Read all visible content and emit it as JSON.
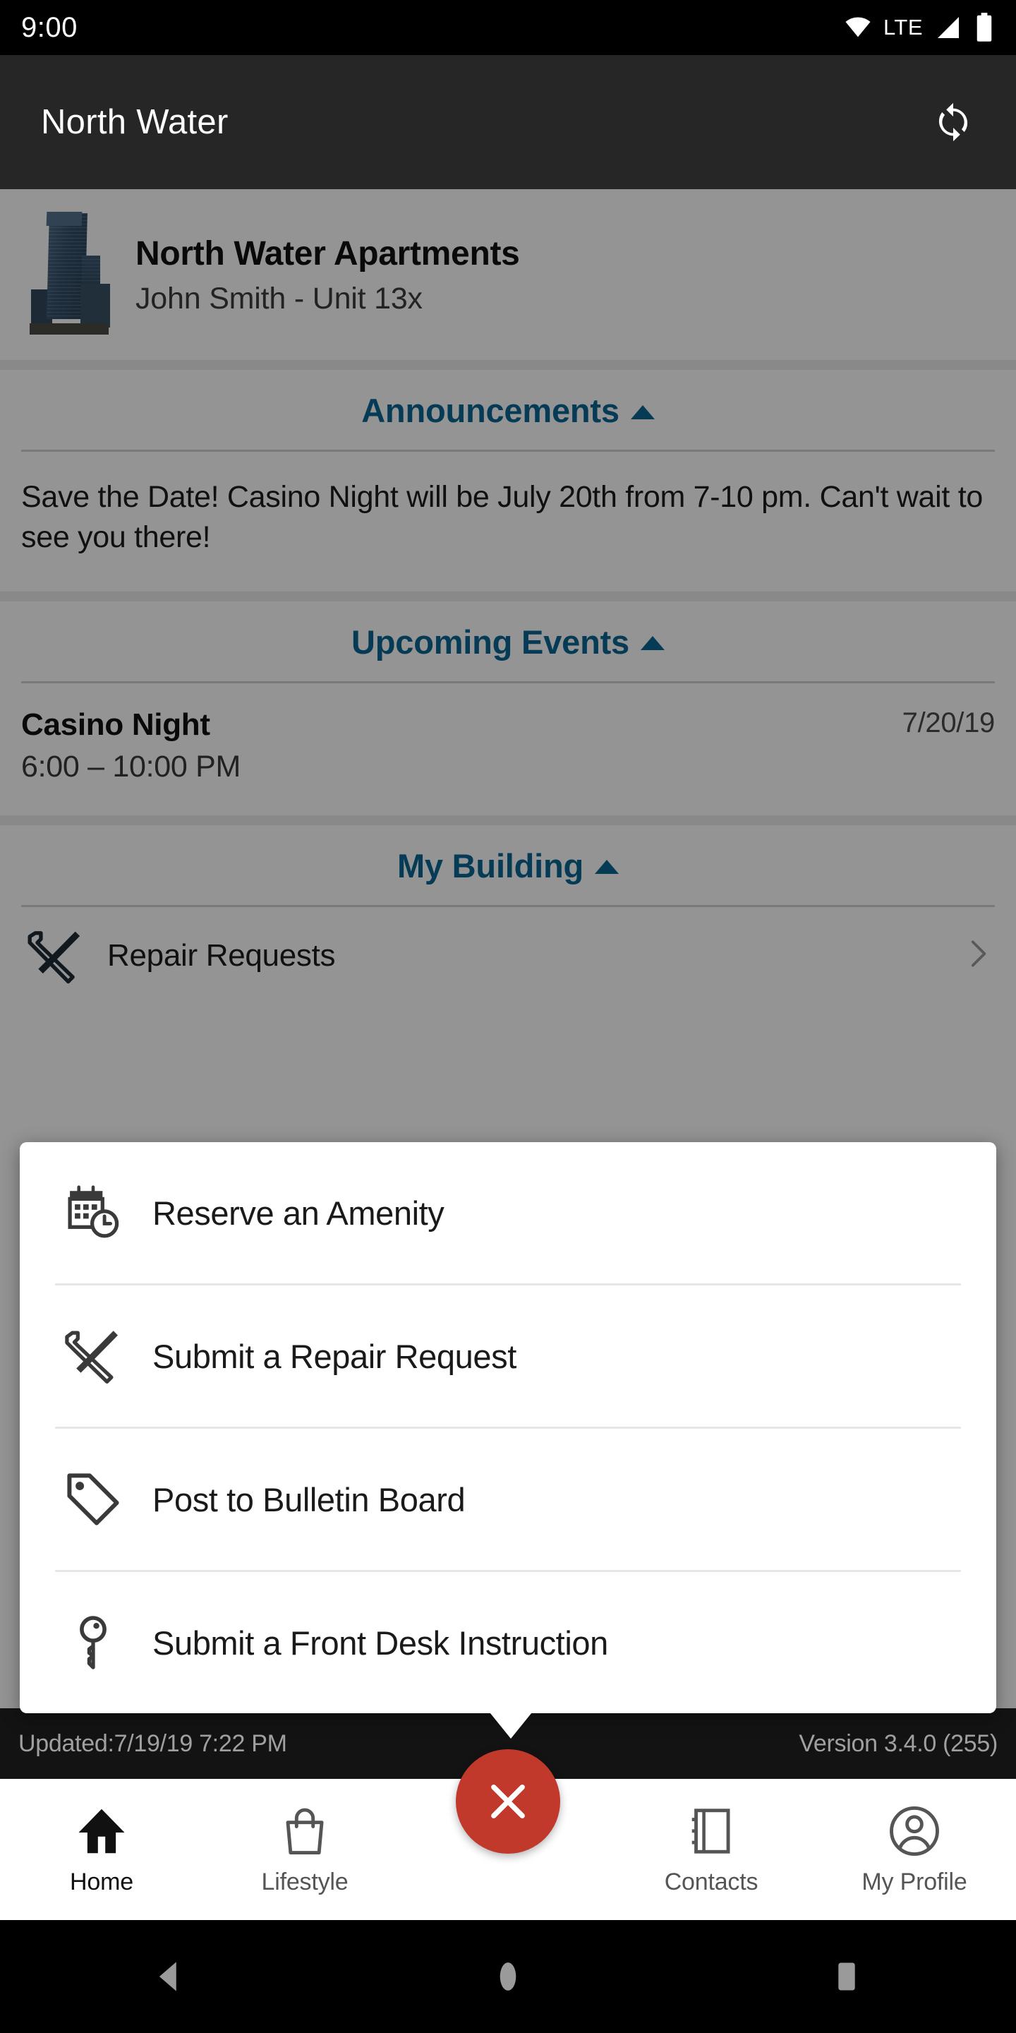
{
  "status_bar": {
    "time": "9:00",
    "network_label": "LTE",
    "icons": [
      "wifi-icon",
      "cellular-signal-icon",
      "battery-icon"
    ]
  },
  "app_bar": {
    "title": "North Water",
    "refresh_icon": "refresh-sync-icon"
  },
  "property": {
    "name": "North Water Apartments",
    "resident": "John Smith - Unit 13x",
    "thumbnail_alt": "building-thumbnail"
  },
  "sections": {
    "announcements": {
      "title": "Announcements",
      "collapse_icon": "caret-up-icon",
      "body": "Save the Date! Casino Night will be July 20th from 7-10 pm. Can't wait to see you there!"
    },
    "upcoming_events": {
      "title": "Upcoming Events",
      "collapse_icon": "caret-up-icon",
      "event_title": "Casino Night",
      "event_time": "6:00 – 10:00 PM",
      "event_date": "7/20/19"
    },
    "my_building": {
      "title": "My Building",
      "collapse_icon": "caret-up-icon",
      "row_label": "Repair Requests",
      "row_icon": "wrench-screwdriver-icon",
      "row_chevron": "chevron-right-icon"
    }
  },
  "popup_menu": {
    "items": [
      {
        "label": "Reserve an Amenity",
        "icon": "calendar-clock-icon"
      },
      {
        "label": "Submit a Repair Request",
        "icon": "wrench-screwdriver-icon"
      },
      {
        "label": "Post to Bulletin Board",
        "icon": "price-tag-icon"
      },
      {
        "label": "Submit a Front Desk Instruction",
        "icon": "key-icon"
      }
    ]
  },
  "footer_meta": {
    "updated": "Updated:7/19/19 7:22 PM",
    "version": "Version 3.4.0 (255)"
  },
  "bottom_nav": {
    "items": [
      {
        "label": "Home",
        "icon": "home-icon",
        "active": true
      },
      {
        "label": "Lifestyle",
        "icon": "shopping-bag-icon",
        "active": false
      },
      {
        "label": "Contacts",
        "icon": "address-book-icon",
        "active": false
      },
      {
        "label": "My Profile",
        "icon": "person-circle-icon",
        "active": false
      }
    ],
    "fab": {
      "icon": "close-x-icon",
      "color": "#c0392b"
    }
  },
  "android_nav": {
    "back_icon": "back-triangle-icon",
    "home_icon": "home-circle-icon",
    "recents_icon": "recents-square-icon"
  },
  "colors": {
    "accent_teal": "#0b6694",
    "fab_red": "#c0392b",
    "appbar_dark": "#262626",
    "meta_dark": "#131313"
  }
}
